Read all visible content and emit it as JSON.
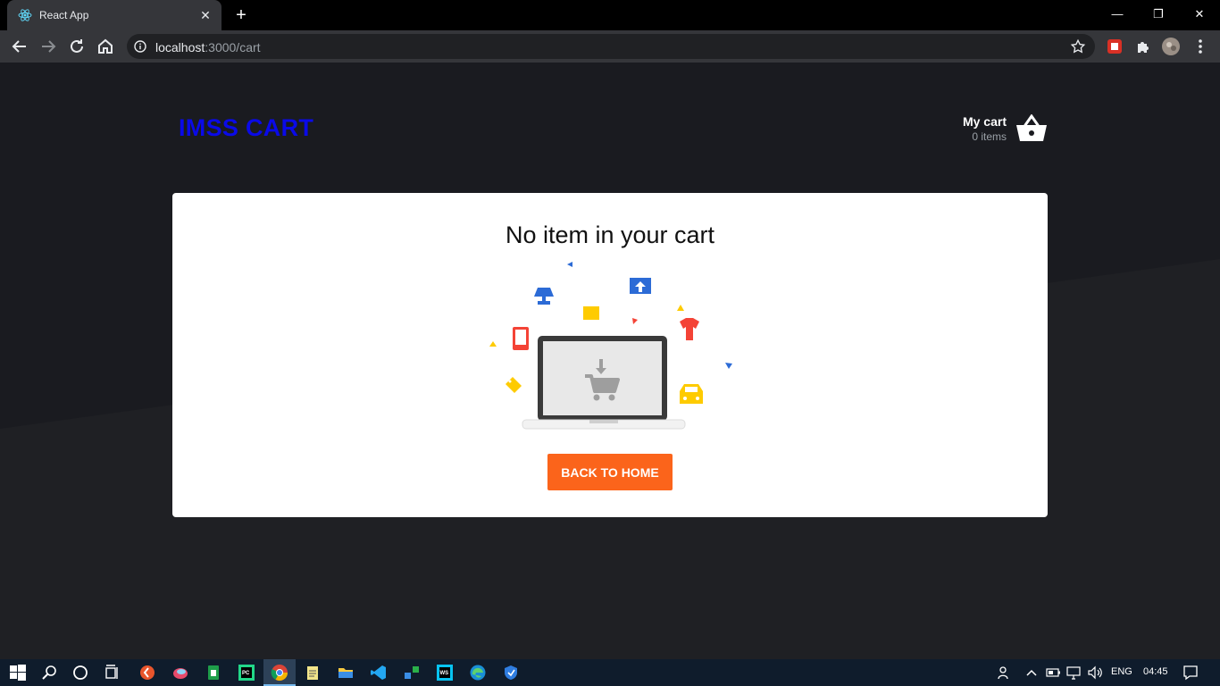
{
  "browser": {
    "tab_title": "React App",
    "tab_close": "✕",
    "new_tab": "+",
    "url_host": "localhost",
    "url_path": ":3000/cart",
    "window_controls": {
      "minimize": "—",
      "restore": "❐",
      "close": "✕"
    }
  },
  "header": {
    "brand": "IMSS CART",
    "cart_title": "My cart",
    "cart_count": "0 items"
  },
  "empty_cart": {
    "message": "No item in your cart",
    "button_label": "BACK TO HOME"
  },
  "taskbar": {
    "language": "ENG",
    "time": "04:45"
  },
  "colors": {
    "page_bg": "#1a1b20",
    "brand": "#0a0ae8",
    "button": "#fb641b",
    "card": "#ffffff"
  }
}
